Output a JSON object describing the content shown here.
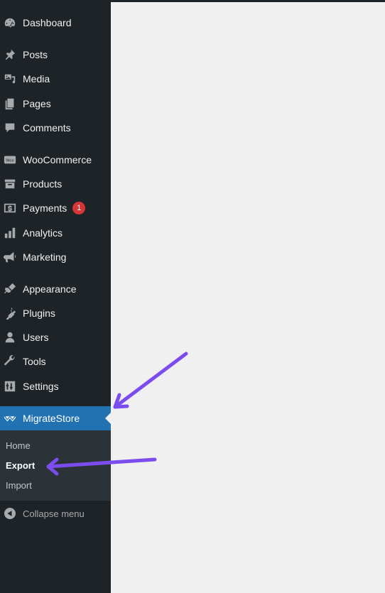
{
  "sidebar": {
    "items": [
      {
        "label": "Dashboard",
        "icon": "dashboard-icon"
      },
      {
        "label": "Posts",
        "icon": "pin-icon"
      },
      {
        "label": "Media",
        "icon": "media-icon"
      },
      {
        "label": "Pages",
        "icon": "pages-icon"
      },
      {
        "label": "Comments",
        "icon": "comment-icon"
      },
      {
        "label": "WooCommerce",
        "icon": "woo-icon"
      },
      {
        "label": "Products",
        "icon": "archive-icon"
      },
      {
        "label": "Payments",
        "icon": "dollar-icon",
        "badge": "1"
      },
      {
        "label": "Analytics",
        "icon": "bar-chart-icon"
      },
      {
        "label": "Marketing",
        "icon": "megaphone-icon"
      },
      {
        "label": "Appearance",
        "icon": "paintbrush-icon"
      },
      {
        "label": "Plugins",
        "icon": "plugin-icon"
      },
      {
        "label": "Users",
        "icon": "user-icon"
      },
      {
        "label": "Tools",
        "icon": "wrench-icon"
      },
      {
        "label": "Settings",
        "icon": "settings-icon"
      },
      {
        "label": "MigrateStore",
        "icon": "migrate-icon"
      }
    ],
    "submenu": [
      {
        "label": "Home"
      },
      {
        "label": "Export"
      },
      {
        "label": "Import"
      }
    ],
    "collapse_label": "Collapse menu"
  },
  "colors": {
    "sidebar_bg": "#1d2327",
    "active_bg": "#2271b1",
    "submenu_bg": "#2c3338",
    "badge_bg": "#d63638",
    "arrow": "#7b4dee",
    "content_bg": "#f0f0f1"
  }
}
